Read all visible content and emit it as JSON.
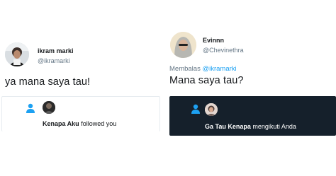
{
  "left_tweet": {
    "author_name": "ikram marki",
    "author_handle": "@ikramarki",
    "text": "ya mana saya tau!",
    "notification": {
      "actor": "Kenapa Aku",
      "action": "followed you",
      "icon": "person-icon"
    }
  },
  "right_tweet": {
    "author_name": "Evinnn",
    "author_handle": "@Chevinethra",
    "reply_prefix": "Membalas",
    "reply_mention": "@ikramarki",
    "text": "Mana saya tau?",
    "notification": {
      "actor": "Ga Tau Kenapa",
      "action": "mengikuti Anda",
      "icon": "person-icon"
    }
  },
  "colors": {
    "accent": "#1da1f2",
    "dark_card": "#15202b",
    "muted_text": "#657786"
  }
}
